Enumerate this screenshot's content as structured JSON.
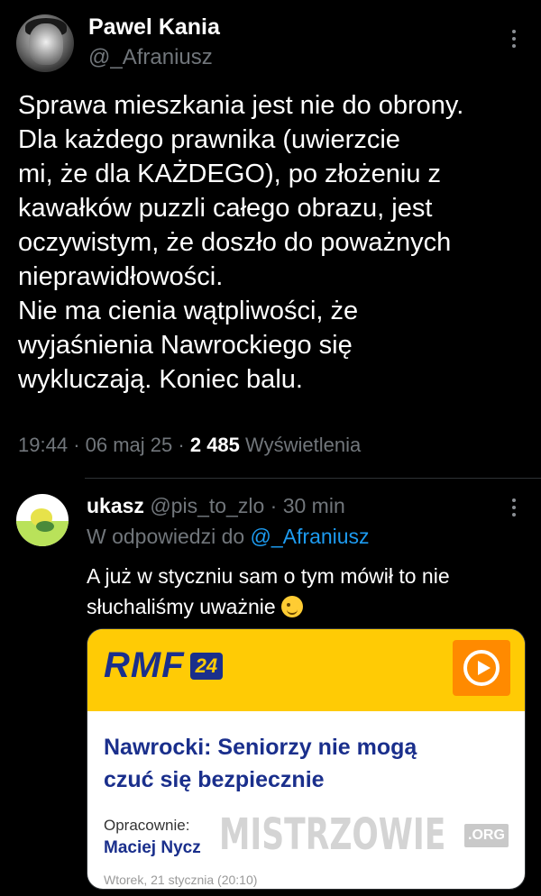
{
  "tweet": {
    "author_name": "Pawel Kania",
    "author_handle": "@_Afraniusz",
    "text": "Sprawa mieszkania jest nie do obrony.\nDla każdego prawnika (uwierzcie\nmi, że dla KAŻDEGO), po złożeniu z\nkawałków puzzli całego obrazu, jest\noczywistym, że doszło do poważnych\nnieprawidłowości.\nNie ma cienia wątpliwości, że\nwyjaśnienia Nawrockiego się\nwykluczają. Koniec balu.",
    "time": "19:44",
    "date": "06 maj 25",
    "views_count": "2 485",
    "views_label": "Wyświetlenia",
    "separator": "·"
  },
  "reply": {
    "author_name": "ukasz",
    "author_handle": "@pis_to_zlo",
    "age": "30 min",
    "reply_to_label": "W odpowiedzi do",
    "reply_to_handle": "@_Afraniusz",
    "text": "A już w styczniu sam o tym mówił to nie\nsłuchaliśmy uważnie",
    "emoji": "winking-face"
  },
  "card": {
    "brand": "RMF",
    "brand_number": "24",
    "headline": "Nawrocki: Seniorzy nie mogą\nczuć się bezpiecznie",
    "author_label": "Opracownie:",
    "author_name": "Maciej Nycz",
    "date": "Wtorek, 21 stycznia (20:10)",
    "colors": {
      "header": "#ffcb05",
      "brand": "#1a2f8c",
      "play": "#ff8a00"
    }
  },
  "watermark": {
    "text": "MISTRZOWIE",
    "suffix": ".ORG"
  },
  "colors": {
    "background": "#000000",
    "muted": "#71767b",
    "link": "#1d9bf0"
  }
}
